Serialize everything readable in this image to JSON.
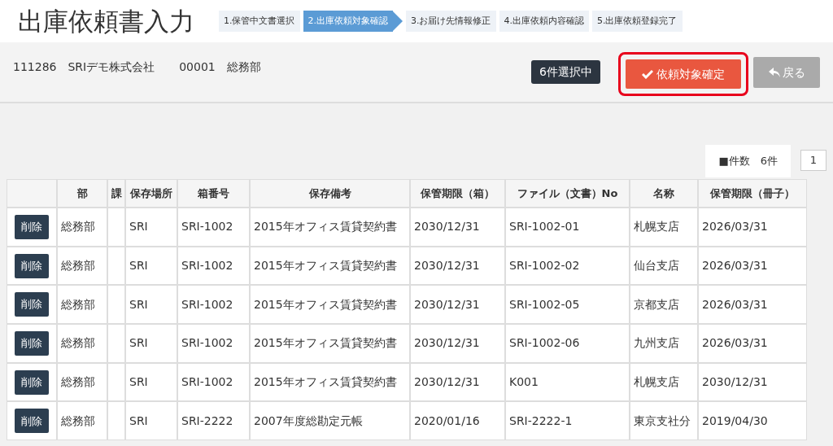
{
  "title": "出庫依頼書入力",
  "steps": [
    {
      "label": "1.保管中文書選択",
      "selected": false
    },
    {
      "label": "2.出庫依頼対象確認",
      "selected": true
    },
    {
      "label": "3.お届け先情報修正",
      "selected": false
    },
    {
      "label": "4.出庫依頼内容確認",
      "selected": false
    },
    {
      "label": "5.出庫依頼登録完了",
      "selected": false
    }
  ],
  "header": {
    "company_code": "111286",
    "company_name": "SRIデモ株式会社",
    "dept_code": "00001",
    "dept_name": "総務部",
    "selected_count": "6件選択中",
    "confirm_button": "依頼対象確定",
    "back_button": "戻る",
    "confirm_highlighted": true
  },
  "count_label": "■件数　6件",
  "page": "1",
  "table": {
    "columns": [
      "部",
      "課",
      "保存場所",
      "箱番号",
      "保存備考",
      "保管期限（箱）",
      "ファイル（文書）No",
      "名称",
      "保管期限（冊子）"
    ],
    "rows": [
      {
        "action": "削除",
        "cells": [
          "総務部",
          "",
          "SRI",
          "SRI-1002",
          "2015年オフィス賃貸契約書",
          "2030/12/31",
          "SRI-1002-01",
          "札幌支店",
          "2026/03/31"
        ]
      },
      {
        "action": "削除",
        "cells": [
          "総務部",
          "",
          "SRI",
          "SRI-1002",
          "2015年オフィス賃貸契約書",
          "2030/12/31",
          "SRI-1002-02",
          "仙台支店",
          "2026/03/31"
        ]
      },
      {
        "action": "削除",
        "cells": [
          "総務部",
          "",
          "SRI",
          "SRI-1002",
          "2015年オフィス賃貸契約書",
          "2030/12/31",
          "SRI-1002-05",
          "京都支店",
          "2026/03/31"
        ]
      },
      {
        "action": "削除",
        "cells": [
          "総務部",
          "",
          "SRI",
          "SRI-1002",
          "2015年オフィス賃貸契約書",
          "2030/12/31",
          "SRI-1002-06",
          "九州支店",
          "2026/03/31"
        ]
      },
      {
        "action": "削除",
        "cells": [
          "総務部",
          "",
          "SRI",
          "SRI-1002",
          "2015年オフィス賃貸契約書",
          "2030/12/31",
          "K001",
          "札幌支店",
          "2030/12/31"
        ]
      },
      {
        "action": "削除",
        "cells": [
          "総務部",
          "",
          "SRI",
          "SRI-2222",
          "2007年度総勘定元帳",
          "2020/01/16",
          "SRI-2222-1",
          "東京支社分",
          "2019/04/30"
        ]
      }
    ]
  }
}
